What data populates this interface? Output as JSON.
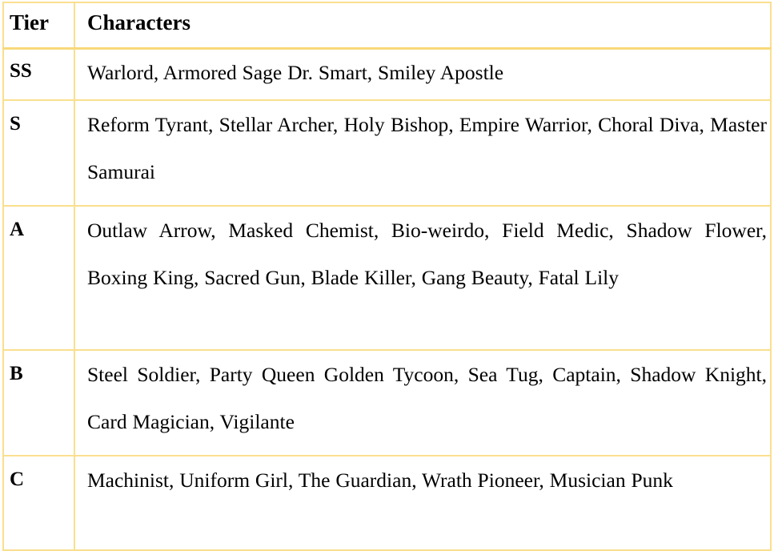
{
  "table": {
    "columns": [
      {
        "key": "tier",
        "label": "Tier"
      },
      {
        "key": "characters",
        "label": "Characters"
      }
    ],
    "rows": [
      {
        "tier": "SS",
        "characters": "Warlord, Armored Sage Dr. Smart, Smiley Apostle"
      },
      {
        "tier": "S",
        "characters": "Reform Tyrant, Stellar Archer, Holy Bishop, Empire Warrior, Choral Diva, Master Samurai"
      },
      {
        "tier": "A",
        "characters": "Outlaw Arrow, Masked Chemist, Bio-weirdo, Field Medic, Shadow Flower, Boxing King, Sacred Gun, Blade Killer, Gang Beauty, Fatal Lily"
      },
      {
        "tier": "B",
        "characters": "Steel Soldier, Party Queen Golden Tycoon, Sea Tug, Captain, Shadow Knight, Card Magician, Vigilante"
      },
      {
        "tier": "C",
        "characters": "Machinist, Uniform Girl, The Guardian, Wrath Pioneer, Musician Punk"
      }
    ]
  },
  "colors": {
    "border": "#fadf8e",
    "header_border": "#f8d97c",
    "text": "#000000",
    "background": "#ffffff"
  }
}
